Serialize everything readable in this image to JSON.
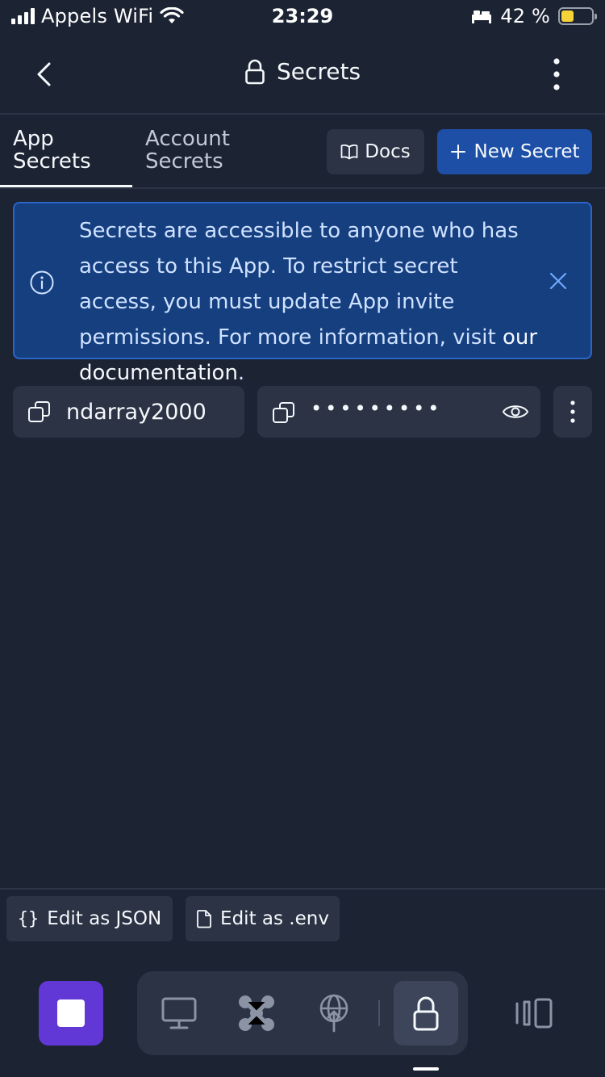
{
  "status_bar": {
    "carrier": "Appels WiFi",
    "time": "23:29",
    "battery": "42 %",
    "battery_level": 0.42,
    "icons": [
      "signal-icon",
      "wifi-icon",
      "bed-icon",
      "battery-icon"
    ]
  },
  "header": {
    "title": "Secrets",
    "icons": [
      "chevron-left-icon",
      "lock-icon",
      "more-vertical-icon"
    ]
  },
  "tabs": [
    {
      "line1": "App",
      "line2": "Secrets",
      "active": true
    },
    {
      "line1": "Account",
      "line2": "Secrets",
      "active": false
    }
  ],
  "actions": {
    "docs_label": "Docs",
    "new_secret_label": "New Secret"
  },
  "banner": {
    "text": "Secrets are accessible to anyone who has access to this App. To restrict secret access, you must update App invite permissions. For more information, visit ",
    "link_text": "our documentation",
    "trailing": "."
  },
  "secrets": [
    {
      "key": "ndarray2000",
      "masked_value": "•••••••••"
    }
  ],
  "footer": {
    "edit_json_icon": "{}",
    "edit_json_label": "Edit as JSON",
    "edit_env_label": "Edit as .env"
  },
  "toolbar": {
    "items": [
      "stop-icon",
      "monitor-icon",
      "packages-icon",
      "deploy-icon",
      "lock-icon",
      "layout-icon"
    ],
    "active": "lock-icon"
  },
  "colors": {
    "background": "#1c2333",
    "surface": "#2b3345",
    "primary": "#1d4fa6",
    "banner": "#163f80",
    "stop": "#6138d6",
    "battery_fill": "#f7d33a"
  }
}
